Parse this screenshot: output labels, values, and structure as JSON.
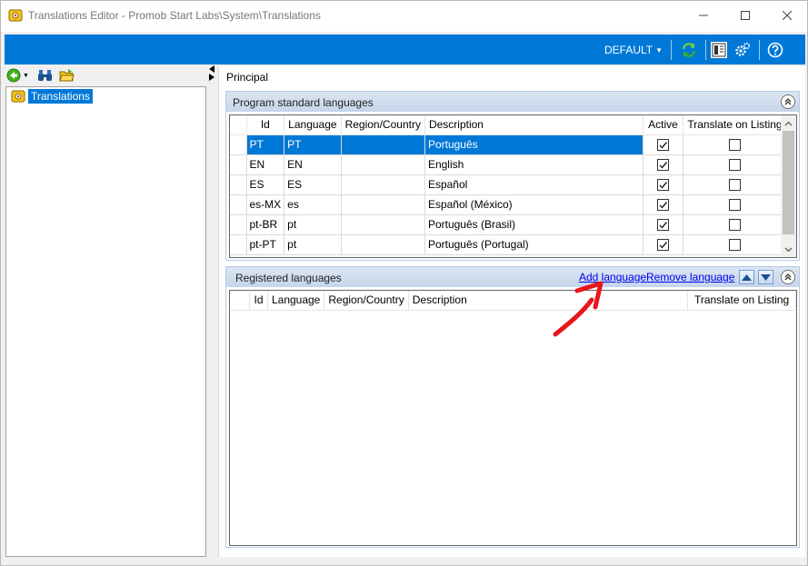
{
  "window": {
    "title": "Translations Editor - Promob Start Labs\\System\\Translations"
  },
  "toolbar": {
    "profile_label": "DEFAULT"
  },
  "tree": {
    "root_label": "Translations"
  },
  "main": {
    "tab_label": "Principal"
  },
  "program_languages": {
    "title": "Program standard languages",
    "columns": [
      "Id",
      "Language",
      "Region/Country",
      "Description",
      "Active",
      "Translate on Listing"
    ],
    "rows": [
      {
        "id": "PT",
        "language": "PT",
        "region": "",
        "description": "Português",
        "active": true,
        "translate": false
      },
      {
        "id": "EN",
        "language": "EN",
        "region": "",
        "description": "English",
        "active": true,
        "translate": false
      },
      {
        "id": "ES",
        "language": "ES",
        "region": "",
        "description": "Español",
        "active": true,
        "translate": false
      },
      {
        "id": "es-MX",
        "language": "es",
        "region": "",
        "description": "Español (México)",
        "active": true,
        "translate": false
      },
      {
        "id": "pt-BR",
        "language": "pt",
        "region": "",
        "description": "Português (Brasil)",
        "active": true,
        "translate": false
      },
      {
        "id": "pt-PT",
        "language": "pt",
        "region": "",
        "description": "Português (Portugal)",
        "active": true,
        "translate": false
      }
    ]
  },
  "registered_languages": {
    "title": "Registered languages",
    "add_label": "Add language",
    "remove_label": "Remove language",
    "columns": [
      "Id",
      "Language",
      "Region/Country",
      "Description",
      "Translate on Listing"
    ]
  },
  "colors": {
    "accent": "#0078d7",
    "annotation": "#e8161b"
  }
}
